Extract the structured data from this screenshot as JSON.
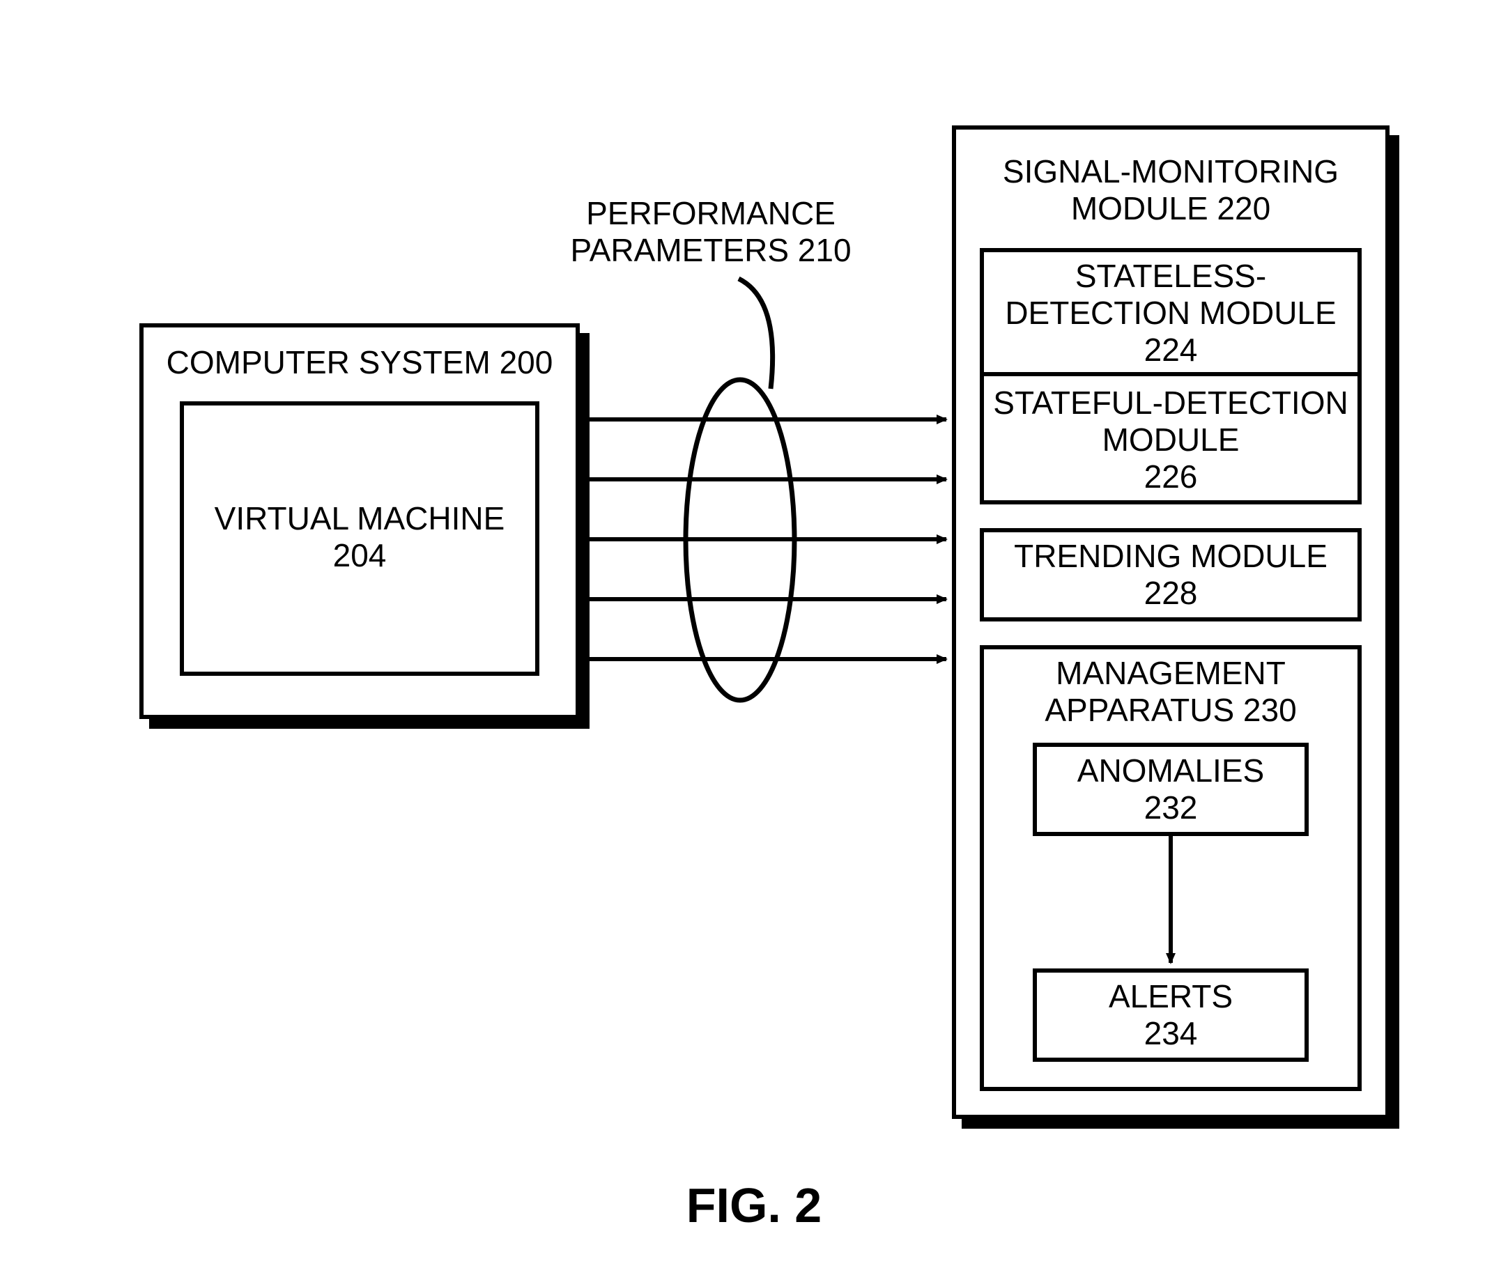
{
  "figureLabel": "FIG. 2",
  "computerSystem": {
    "title": "COMPUTER SYSTEM 200",
    "vm": {
      "line1": "VIRTUAL MACHINE",
      "line2": "204"
    }
  },
  "performanceParams": {
    "line1": "PERFORMANCE",
    "line2": "PARAMETERS 210"
  },
  "signalMonitoring": {
    "title1": "SIGNAL-MONITORING",
    "title2": "MODULE 220",
    "stateless": {
      "l1": "STATELESS-",
      "l2": "DETECTION MODULE",
      "l3": "224"
    },
    "stateful": {
      "l1": "STATEFUL-DETECTION",
      "l2": "MODULE",
      "l3": "226"
    },
    "trending": {
      "l1": "TRENDING MODULE",
      "l2": "228"
    },
    "mgmt": {
      "l1": "MANAGEMENT",
      "l2": "APPARATUS 230",
      "anomalies": {
        "l1": "ANOMALIES",
        "l2": "232"
      },
      "alerts": {
        "l1": "ALERTS",
        "l2": "234"
      }
    }
  }
}
